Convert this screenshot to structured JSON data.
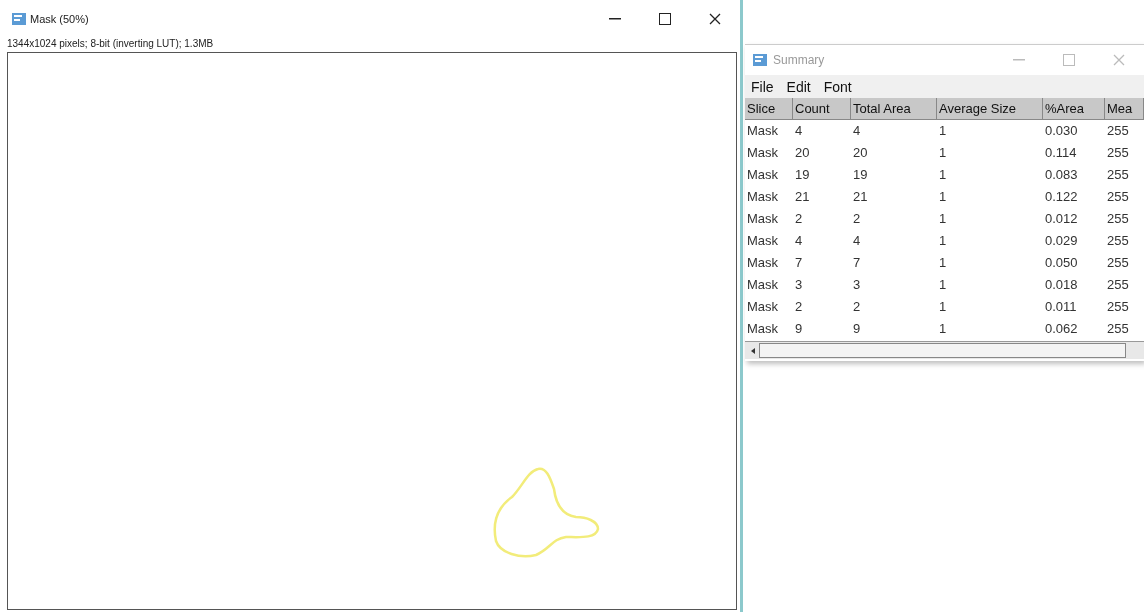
{
  "image_window": {
    "title": "Mask (50%)",
    "info": "1344x1024 pixels; 8-bit (inverting LUT); 1.3MB"
  },
  "summary_window": {
    "title": "Summary",
    "menu": [
      "File",
      "Edit",
      "Font"
    ],
    "columns": [
      "Slice",
      "Count",
      "Total Area",
      "Average Size",
      "%Area",
      "Mea"
    ],
    "rows": [
      [
        "Mask",
        "4",
        "4",
        "1",
        "0.030",
        "255"
      ],
      [
        "Mask",
        "20",
        "20",
        "1",
        "0.114",
        "255"
      ],
      [
        "Mask",
        "19",
        "19",
        "1",
        "0.083",
        "255"
      ],
      [
        "Mask",
        "21",
        "21",
        "1",
        "0.122",
        "255"
      ],
      [
        "Mask",
        "2",
        "2",
        "1",
        "0.012",
        "255"
      ],
      [
        "Mask",
        "4",
        "4",
        "1",
        "0.029",
        "255"
      ],
      [
        "Mask",
        "7",
        "7",
        "1",
        "0.050",
        "255"
      ],
      [
        "Mask",
        "3",
        "3",
        "1",
        "0.018",
        "255"
      ],
      [
        "Mask",
        "2",
        "2",
        "1",
        "0.011",
        "255"
      ],
      [
        "Mask",
        "9",
        "9",
        "1",
        "0.062",
        "255"
      ]
    ]
  }
}
